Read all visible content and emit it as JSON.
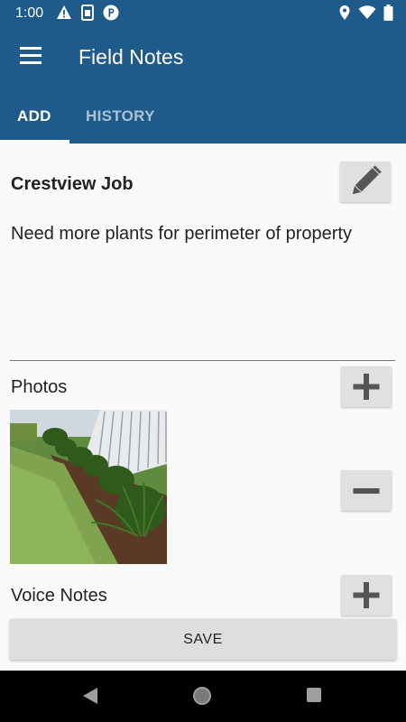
{
  "status_bar": {
    "time": "1:00",
    "icons_left": [
      "warning-icon",
      "sim-icon",
      "parking-icon"
    ],
    "icons_right": [
      "location-icon",
      "wifi-icon",
      "battery-icon"
    ]
  },
  "app_bar": {
    "title": "Field Notes",
    "menu_icon": "hamburger-menu-icon"
  },
  "tabs": [
    {
      "label": "ADD",
      "selected": true
    },
    {
      "label": "HISTORY",
      "selected": false
    }
  ],
  "note": {
    "title": "Crestview Job",
    "body": "Need more plants for perimeter of property",
    "edit_icon": "pencil-icon"
  },
  "photos": {
    "label": "Photos",
    "add_icon": "plus-icon",
    "remove_icon": "minus-icon",
    "items": [
      "garden-photo"
    ]
  },
  "voice_notes": {
    "label": "Voice Notes",
    "add_icon": "plus-icon"
  },
  "save_button": {
    "label": "SAVE"
  },
  "colors": {
    "primary": "#1e5a8a",
    "button_bg": "#e0e0e0",
    "icon_gray": "#555555"
  }
}
